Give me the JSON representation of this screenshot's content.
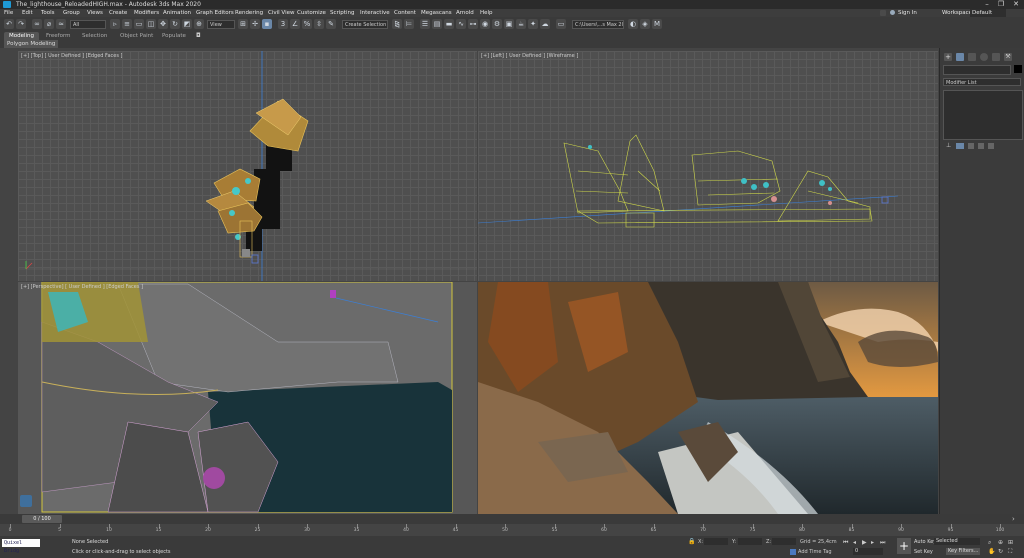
{
  "window": {
    "title": "The_lighthouse_ReloadedHIGH.max - Autodesk 3ds Max 2020"
  },
  "menu": [
    "File",
    "Edit",
    "Tools",
    "Group",
    "Views",
    "Create",
    "Modifiers",
    "Animation",
    "Graph Editors",
    "Rendering",
    "Civil View",
    "Customize",
    "Scripting",
    "Interactive",
    "Content",
    "Megascans",
    "Arnold",
    "Help"
  ],
  "account": {
    "sign_in": "Sign In",
    "workspaces_label": "Workspaces:",
    "workspaces_value": "Default"
  },
  "toolbar": {
    "filter_value": "All",
    "view_value": "View",
    "selection_set": "Create Selection Se",
    "path_value": "C:\\Users\\...s Max 2020"
  },
  "ribbon": {
    "tabs": [
      "Modeling",
      "Freeform",
      "Selection",
      "Object Paint",
      "Populate"
    ],
    "sub": "Polygon Modeling"
  },
  "viewports": {
    "top": "[+] [Top] [ User Defined ] [Edged Faces ]",
    "left": "[+] [Left] [ User Defined ] [Wireframe ]",
    "persp": "[+] [Perspective] [ User Defined ] [Edged Faces ]"
  },
  "command_panel": {
    "modifier_list": "Modifier List"
  },
  "timeline": {
    "frame_counter": "0 / 100",
    "ticks": [
      "0",
      "5",
      "10",
      "15",
      "20",
      "25",
      "30",
      "35",
      "40",
      "45",
      "50",
      "55",
      "60",
      "65",
      "70",
      "75",
      "80",
      "85",
      "90",
      "95",
      "100"
    ]
  },
  "status": {
    "maxscript": "Quixel Bridg",
    "selection": "None Selected",
    "prompt": "Click or click-and-drag to select objects",
    "x_label": "X:",
    "y_label": "Y:",
    "z_label": "Z:",
    "grid": "Grid = 25,4cm",
    "add_time_tag": "Add Time Tag",
    "auto_key": "Auto Key",
    "set_key": "Set Key",
    "selected_value": "Selected",
    "key_filters": "Key Filters...",
    "current_frame": "0"
  }
}
